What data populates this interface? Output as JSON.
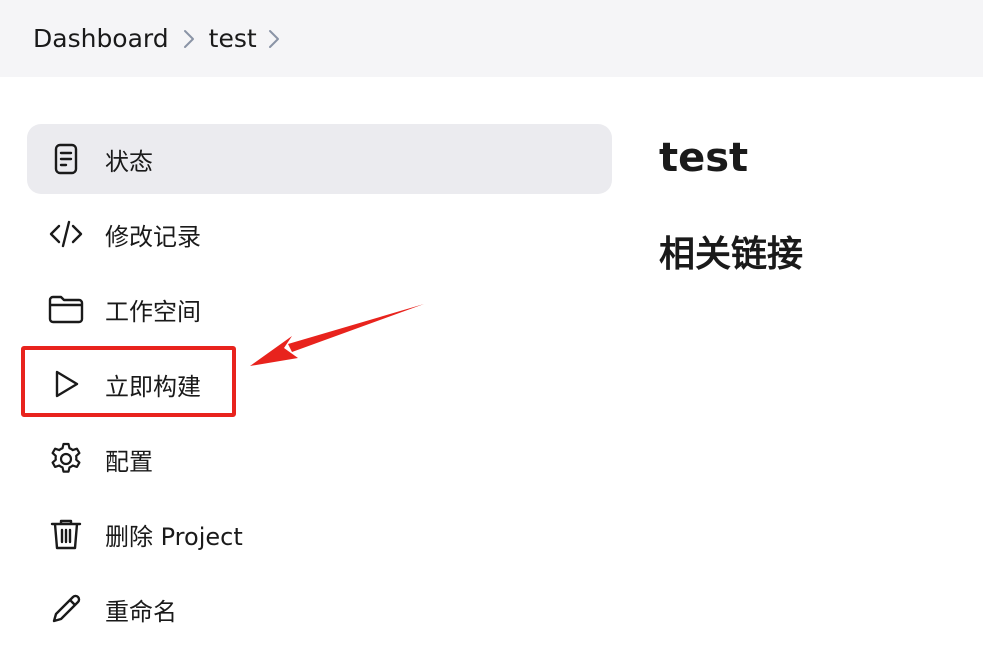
{
  "breadcrumb": {
    "items": [
      "Dashboard",
      "test"
    ]
  },
  "sidebar": {
    "items": [
      {
        "label": "状态",
        "icon": "document-icon",
        "active": true
      },
      {
        "label": "修改记录",
        "icon": "code-icon",
        "active": false
      },
      {
        "label": "工作空间",
        "icon": "folder-icon",
        "active": false
      },
      {
        "label": "立即构建",
        "icon": "play-icon",
        "active": false
      },
      {
        "label": "配置",
        "icon": "gear-icon",
        "active": false
      },
      {
        "label": "删除 Project",
        "icon": "trash-icon",
        "active": false
      },
      {
        "label": "重命名",
        "icon": "pencil-icon",
        "active": false
      }
    ]
  },
  "main": {
    "title": "test",
    "section_title": "相关链接"
  },
  "annotation": {
    "color": "#e8231d",
    "target": "立即构建"
  }
}
